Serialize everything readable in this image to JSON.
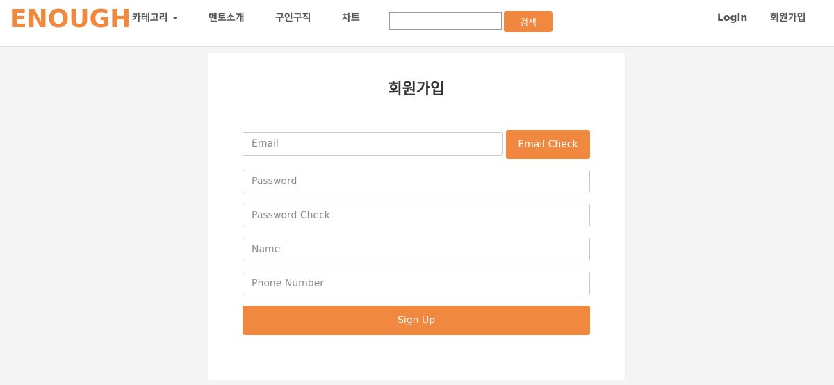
{
  "brand": "ENOUGH",
  "nav": {
    "category_label": "카테고리",
    "mentor_label": "멘토소개",
    "jobs_label": "구인구직",
    "chart_label": "차트",
    "search_placeholder": "",
    "search_button": "검색",
    "login_label": "Login",
    "signup_label": "회원가입"
  },
  "form": {
    "title": "회원가입",
    "email_placeholder": "Email",
    "email_check_button": "Email Check",
    "password_placeholder": "Password",
    "password_check_placeholder": "Password Check",
    "name_placeholder": "Name",
    "phone_placeholder": "Phone Number",
    "submit_button": "Sign Up"
  },
  "colors": {
    "accent": "#f0893f",
    "background": "#f4f4f4",
    "card": "#ffffff"
  },
  "icons": {
    "category_dropdown": "caret-down-icon"
  }
}
